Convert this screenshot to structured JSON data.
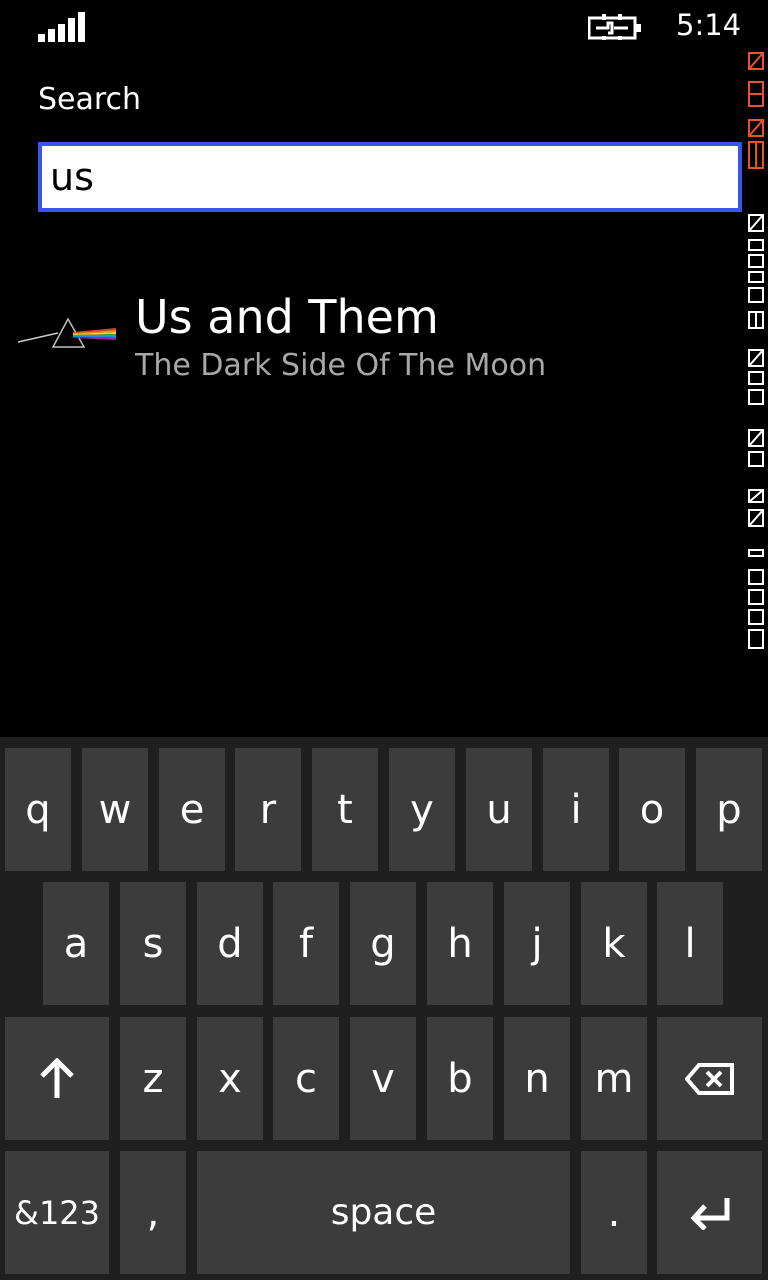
{
  "status": {
    "time": "5:14",
    "icons": [
      "signal-icon",
      "battery-charging-icon"
    ]
  },
  "search": {
    "label": "Search",
    "value": "us",
    "placeholder": ""
  },
  "results": [
    {
      "title": "Us and Them",
      "subtitle": "The Dark Side Of The Moon",
      "art": "prism-album-art-icon"
    }
  ],
  "keyboard": {
    "row1": [
      "q",
      "w",
      "e",
      "r",
      "t",
      "y",
      "u",
      "i",
      "o",
      "p"
    ],
    "row2": [
      "a",
      "s",
      "d",
      "f",
      "g",
      "h",
      "j",
      "k",
      "l"
    ],
    "row3": [
      "z",
      "x",
      "c",
      "v",
      "b",
      "n",
      "m"
    ],
    "shift_icon": "shift-arrow-icon",
    "backspace_icon": "backspace-icon",
    "symbols_label": "&123",
    "comma_label": ",",
    "space_label": "space",
    "period_label": ".",
    "enter_icon": "enter-icon"
  },
  "colors": {
    "background": "#000000",
    "search_border": "#3a56e8",
    "key_bg": "#3c3c3c",
    "keyboard_bg": "#1f1f1f",
    "subtitle": "#a8a8a8",
    "debug_accent": "#e8532b"
  }
}
